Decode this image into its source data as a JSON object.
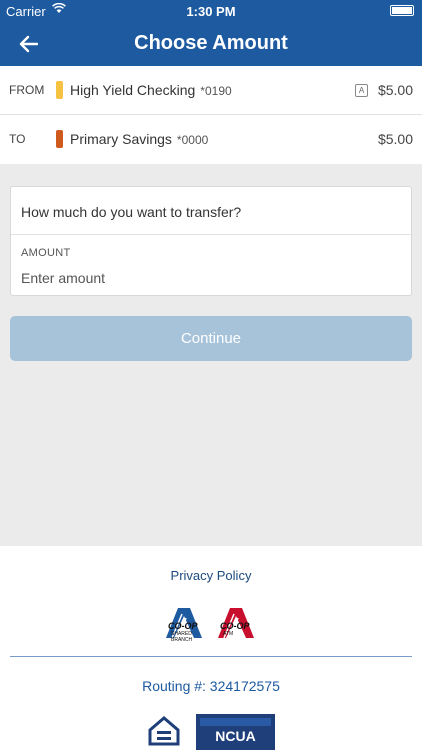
{
  "status_bar": {
    "carrier": "Carrier",
    "time": "1:30 PM"
  },
  "nav": {
    "title": "Choose Amount"
  },
  "transfer": {
    "from": {
      "label": "FROM",
      "account_name": "High Yield Checking",
      "account_number": "*0190",
      "badge": "A",
      "amount": "$5.00",
      "color": "#f5c242"
    },
    "to": {
      "label": "TO",
      "account_name": "Primary Savings",
      "account_number": "*0000",
      "amount": "$5.00",
      "color": "#cf5a1e"
    }
  },
  "form": {
    "question": "How much do you want to transfer?",
    "amount_label": "AMOUNT",
    "amount_placeholder": "Enter amount",
    "amount_value": ""
  },
  "continue_label": "Continue",
  "footer": {
    "privacy_label": "Privacy Policy",
    "logos": [
      {
        "name": "coop-shared-branch-logo",
        "text": "CO-OP",
        "sub": "SHARED BRANCH",
        "color": "#1e5aa0"
      },
      {
        "name": "coop-atm-logo",
        "text": "CO-OP",
        "sub": "ATM",
        "color": "#c8102e"
      }
    ],
    "routing": "Routing #: 324172575",
    "ehl_text": "EQUAL HOUSING LENDER",
    "ncua_text": "NCUA"
  },
  "colors": {
    "primary": "#1e5aa0",
    "button_disabled": "#a7c3da",
    "background": "#ebebeb"
  }
}
